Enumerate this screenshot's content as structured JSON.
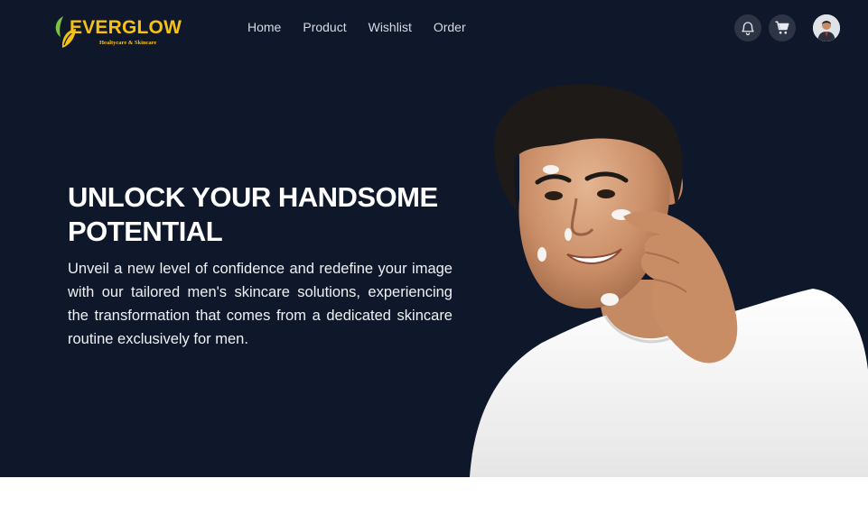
{
  "brand": {
    "name": "EVERGLOW",
    "tagline": "Healtycare & Skincare"
  },
  "nav": {
    "items": [
      {
        "label": "Home"
      },
      {
        "label": "Product"
      },
      {
        "label": "Wishlist"
      },
      {
        "label": "Order"
      }
    ]
  },
  "header_icons": [
    "bell-icon",
    "cart-icon",
    "user-avatar"
  ],
  "hero": {
    "title": "UNLOCK YOUR HANDSOME POTENTIAL",
    "description": "Unveil a new level of confidence and redefine your image with our tailored men's skincare solutions, experiencing the transformation that comes from a dedicated skincare routine exclusively for men."
  },
  "colors": {
    "hero_background": "#0f182b",
    "brand_yellow": "#f4c114",
    "leaf_green": "#7dc242",
    "icon_button_bg": "#2d3445",
    "nav_text": "#d6dae3",
    "page_background": "#ffffff"
  }
}
